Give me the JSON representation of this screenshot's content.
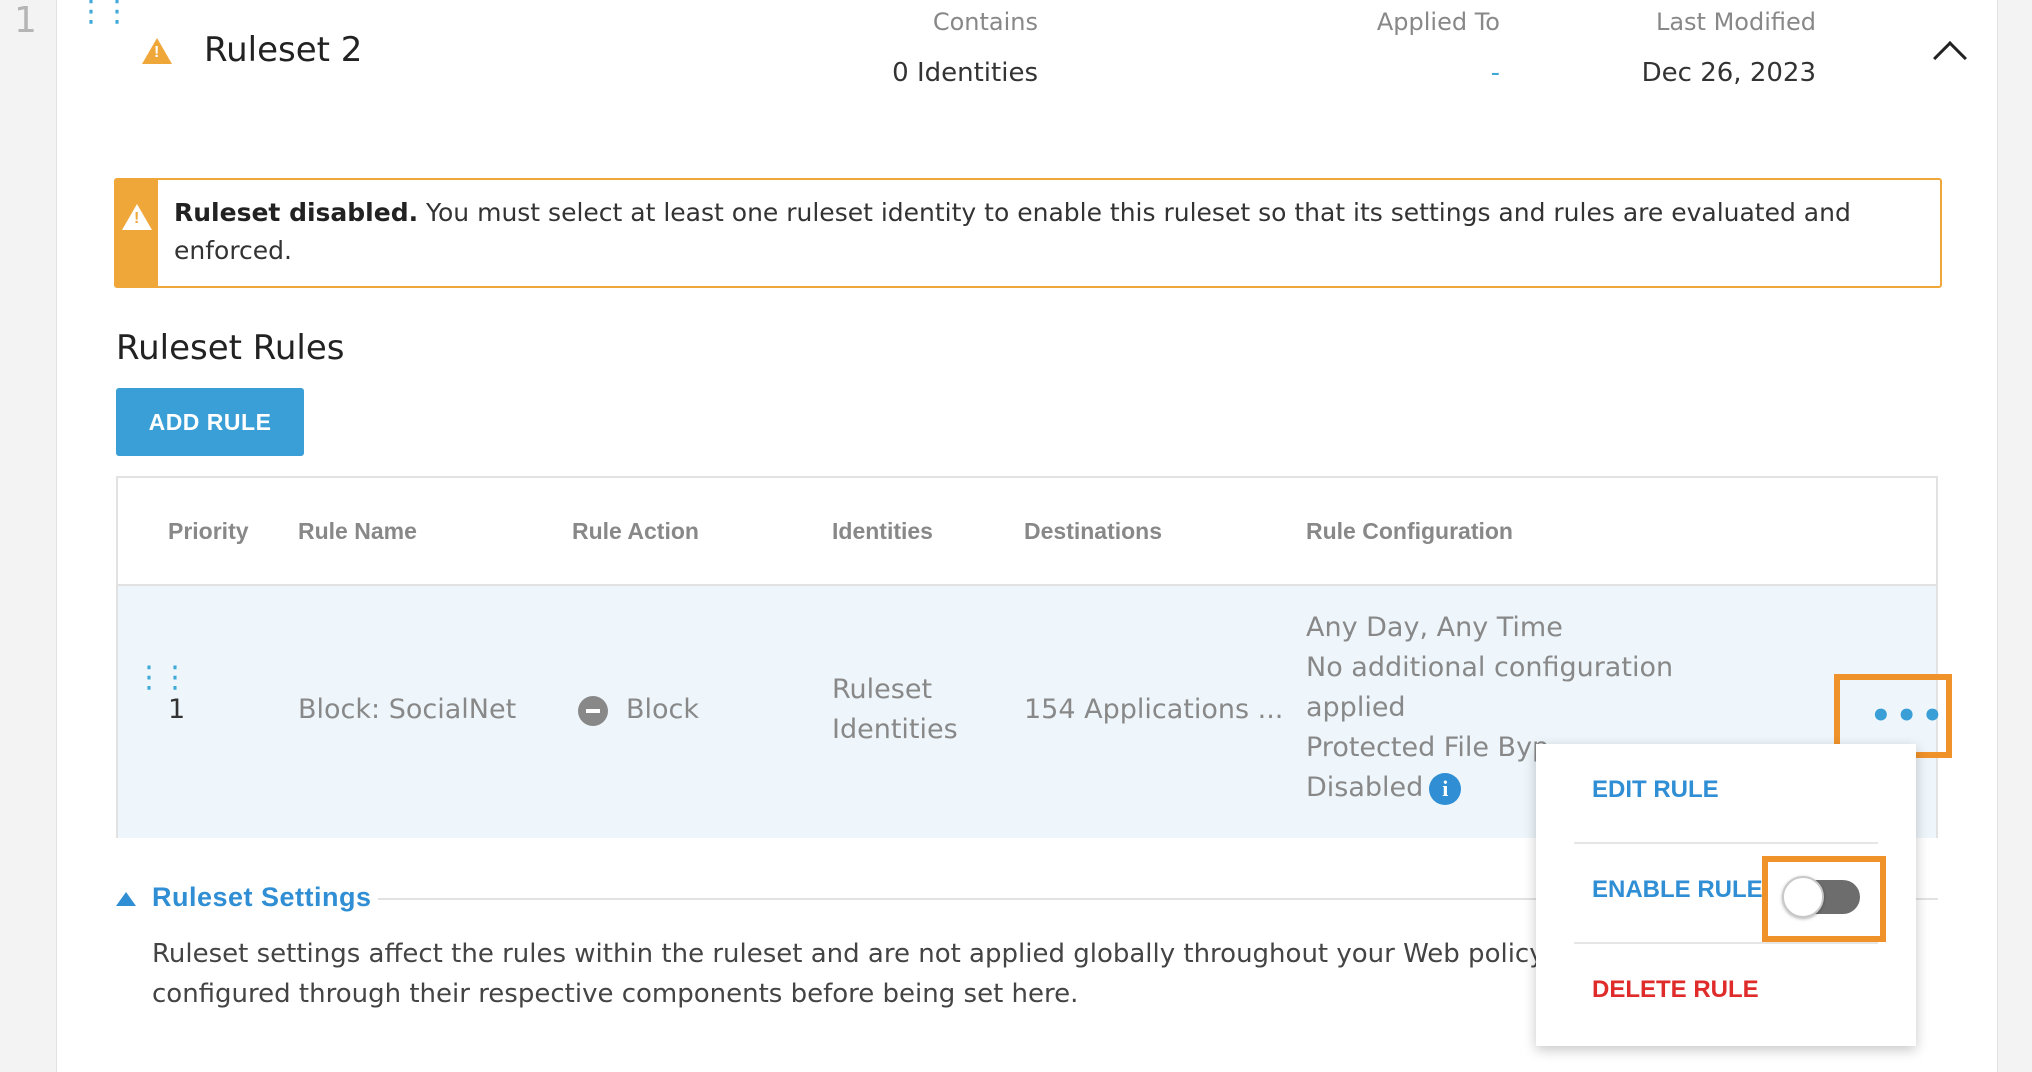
{
  "row_index": "1",
  "ruleset": {
    "title": "Ruleset 2",
    "contains_label": "Contains",
    "contains_value": "0 Identities",
    "applied_label": "Applied To",
    "applied_value": "-",
    "modified_label": "Last Modified",
    "modified_value": "Dec 26, 2023"
  },
  "alert": {
    "strong": "Ruleset disabled.",
    "message": "You must select at least one ruleset identity to enable this ruleset so that its settings and rules are evaluated and enforced."
  },
  "rules_section": {
    "title": "Ruleset Rules",
    "add_button": "ADD RULE"
  },
  "table": {
    "headers": [
      "Priority",
      "Rule Name",
      "Rule Action",
      "Identities",
      "Destinations",
      "Rule Configuration"
    ],
    "row": {
      "priority": "1",
      "name": "Block: SocialNet",
      "action": "Block",
      "identities_line1": "Ruleset",
      "identities_line2": "Identities",
      "destinations": "154 Applications ...",
      "config_line1": "Any Day, Any Time",
      "config_line2": "No additional configuration",
      "config_line3": "applied",
      "config_line4": "Protected File Byp",
      "config_line5": "Disabled"
    }
  },
  "settings": {
    "title": "Ruleset Settings",
    "desc_line1": "Ruleset settings affect the rules within the ruleset and are not applied globally throughout your Web policy. Var",
    "desc_line2": "configured through their respective components before being set here."
  },
  "menu": {
    "edit": "EDIT RULE",
    "enable": "ENABLE RULE",
    "delete": "DELETE RULE",
    "enable_toggle_on": false
  },
  "colors": {
    "accent": "#3a9fd6",
    "warning": "#f0a73a",
    "highlight": "#f0922a",
    "danger": "#e02b2b"
  }
}
